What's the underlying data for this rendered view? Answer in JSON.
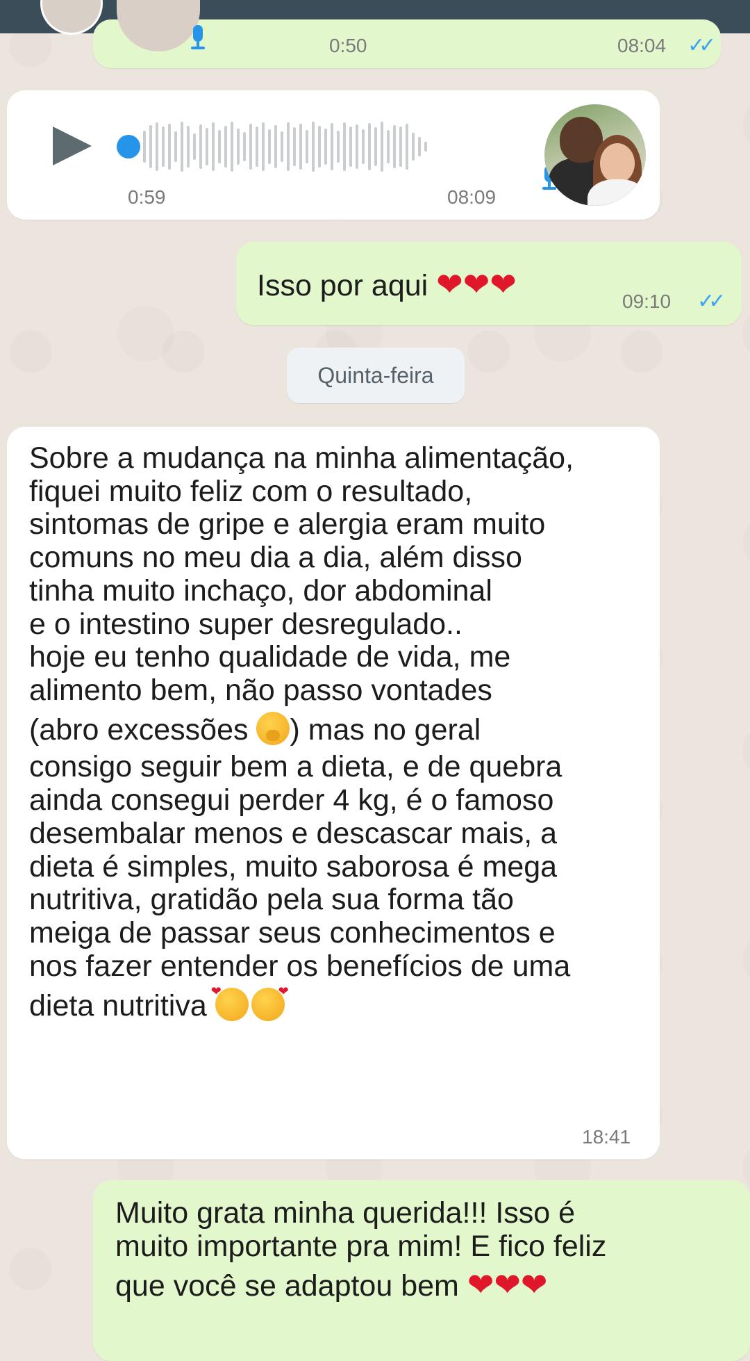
{
  "messages": {
    "voice_out": {
      "duration": "0:50",
      "time": "08:04",
      "ticks": "✓✓"
    },
    "voice_in": {
      "duration": "0:59",
      "time": "08:09"
    },
    "text_out_1": {
      "text": "Isso por aqui",
      "hearts": "❤❤❤",
      "time": "09:10",
      "ticks": "✓✓"
    },
    "day_separator": "Quinta-feira",
    "text_in_long": {
      "lines": [
        "Sobre a mudança na minha alimentação,",
        "fiquei muito feliz com o resultado,",
        "sintomas de gripe e alergia eram muito",
        "comuns no meu dia a dia, além disso",
        "tinha muito inchaço, dor abdominal",
        "e o intestino super desregulado..",
        "hoje eu tenho qualidade de vida, me",
        "alimento bem, não passo vontades",
        "(abro excessões",
        ") mas no geral",
        "consigo seguir bem a dieta, e de quebra",
        "ainda consegui perder 4 kg, é o famoso",
        "desembalar menos e descascar mais, a",
        "dieta é simples, muito saborosa é mega",
        "nutritiva, gratidão pela sua forma tão",
        "meiga de passar seus conhecimentos e",
        "nos fazer entender os benefícios de uma",
        "dieta nutritiva"
      ],
      "time": "18:41"
    },
    "text_out_2": {
      "lines": [
        "Muito grata minha querida!!! Isso é",
        "muito importante pra mim! E fico feliz",
        "que você se adaptou bem"
      ],
      "hearts": "❤❤❤"
    }
  },
  "icons": {
    "play": "play-icon",
    "mic": "microphone-icon",
    "emoji_hand": "face-with-hand-over-mouth-emoji",
    "emoji_love": "smiling-face-with-hearts-emoji"
  },
  "colors": {
    "outgoing_bubble": "#e2f7cb",
    "incoming_bubble": "#ffffff",
    "header": "#3b4d58",
    "read_ticks": "#3aa3f2"
  }
}
